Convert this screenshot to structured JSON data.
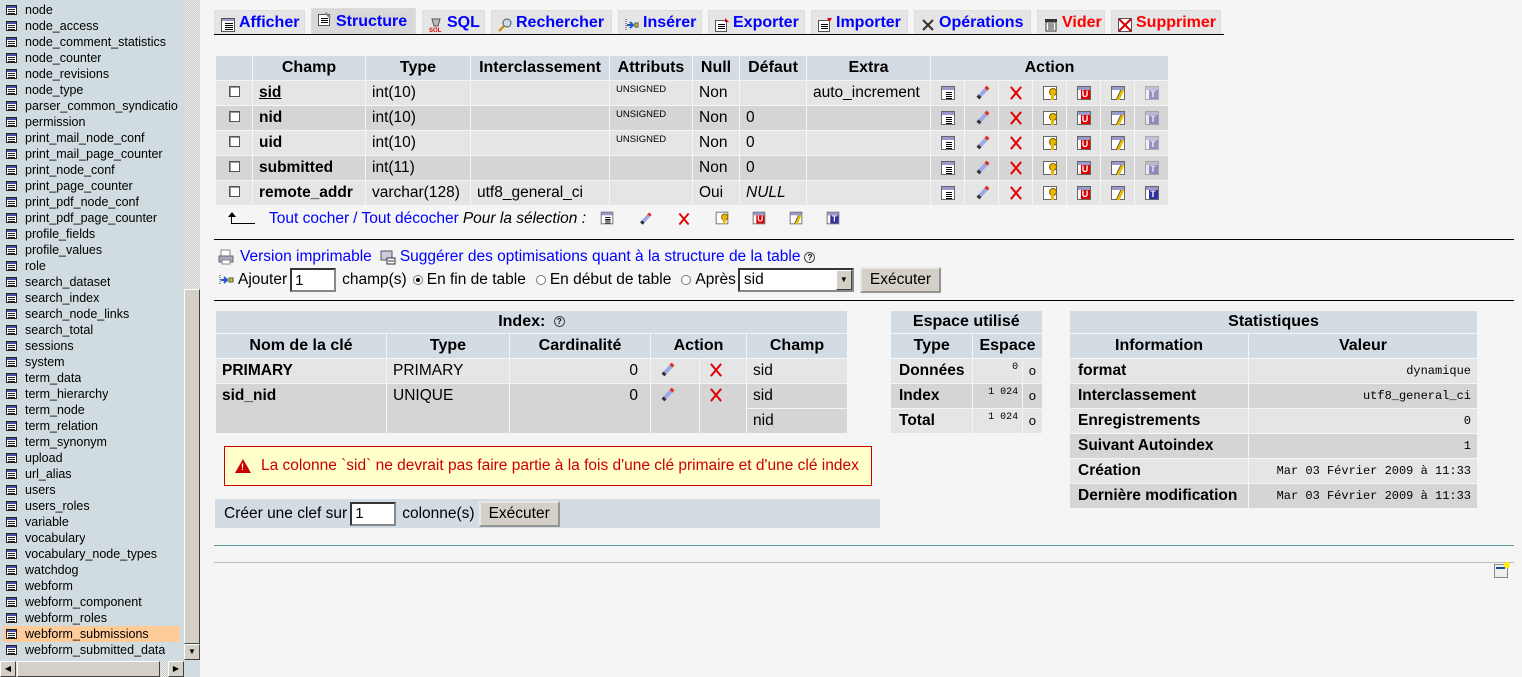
{
  "sidebar": {
    "tables": [
      "node",
      "node_access",
      "node_comment_statistics",
      "node_counter",
      "node_revisions",
      "node_type",
      "parser_common_syndicatio",
      "permission",
      "print_mail_node_conf",
      "print_mail_page_counter",
      "print_node_conf",
      "print_page_counter",
      "print_pdf_node_conf",
      "print_pdf_page_counter",
      "profile_fields",
      "profile_values",
      "role",
      "search_dataset",
      "search_index",
      "search_node_links",
      "search_total",
      "sessions",
      "system",
      "term_data",
      "term_hierarchy",
      "term_node",
      "term_relation",
      "term_synonym",
      "upload",
      "url_alias",
      "users",
      "users_roles",
      "variable",
      "vocabulary",
      "vocabulary_node_types",
      "watchdog",
      "webform",
      "webform_component",
      "webform_roles",
      "webform_submissions",
      "webform_submitted_data"
    ],
    "active_table": "webform_submissions",
    "active_color": "#ffcc99"
  },
  "tabs": [
    {
      "label": "Afficher",
      "icon": "browse-icon",
      "active": false,
      "danger": false
    },
    {
      "label": "Structure",
      "icon": "structure-icon",
      "active": true,
      "danger": false
    },
    {
      "label": "SQL",
      "icon": "sql-icon",
      "active": false,
      "danger": false
    },
    {
      "label": "Rechercher",
      "icon": "search-icon",
      "active": false,
      "danger": false
    },
    {
      "label": "Insérer",
      "icon": "insert-icon",
      "active": false,
      "danger": false
    },
    {
      "label": "Exporter",
      "icon": "export-icon",
      "active": false,
      "danger": false
    },
    {
      "label": "Importer",
      "icon": "import-icon",
      "active": false,
      "danger": false
    },
    {
      "label": "Opérations",
      "icon": "operations-icon",
      "active": false,
      "danger": false
    },
    {
      "label": "Vider",
      "icon": "empty-icon",
      "active": false,
      "danger": true
    },
    {
      "label": "Supprimer",
      "icon": "drop-icon",
      "active": false,
      "danger": true
    }
  ],
  "structure": {
    "headers": [
      "Champ",
      "Type",
      "Interclassement",
      "Attributs",
      "Null",
      "Défaut",
      "Extra",
      "Action"
    ],
    "rows": [
      {
        "field": "sid",
        "type": "int(10)",
        "collation": "",
        "attributes": "UNSIGNED",
        "null": "Non",
        "default": "",
        "extra": "auto_increment",
        "primary": true,
        "fulltext_enabled": false
      },
      {
        "field": "nid",
        "type": "int(10)",
        "collation": "",
        "attributes": "UNSIGNED",
        "null": "Non",
        "default": "0",
        "extra": "",
        "primary": false,
        "fulltext_enabled": false
      },
      {
        "field": "uid",
        "type": "int(10)",
        "collation": "",
        "attributes": "UNSIGNED",
        "null": "Non",
        "default": "0",
        "extra": "",
        "primary": false,
        "fulltext_enabled": false
      },
      {
        "field": "submitted",
        "type": "int(11)",
        "collation": "",
        "attributes": "",
        "null": "Non",
        "default": "0",
        "extra": "",
        "primary": false,
        "fulltext_enabled": false
      },
      {
        "field": "remote_addr",
        "type": "varchar(128)",
        "collation": "utf8_general_ci",
        "attributes": "",
        "null": "Oui",
        "default": "NULL",
        "extra": "",
        "primary": false,
        "fulltext_enabled": true
      }
    ],
    "action_icons": [
      "browse-icon",
      "edit-icon",
      "delete-icon",
      "primary-key-icon",
      "unique-icon",
      "index-icon",
      "fulltext-icon"
    ],
    "check_all": "Tout cocher",
    "separator": "/",
    "uncheck_all": "Tout décocher",
    "with_selected": "Pour la sélection :"
  },
  "tools": {
    "print_view": "Version imprimable",
    "propose_structure": "Suggérer des optimisations quant à la structure de la table",
    "add_label": "Ajouter",
    "add_count": "1",
    "fields_label": "champ(s)",
    "pos_end": "En fin de table",
    "pos_start": "En début de table",
    "pos_after": "Après",
    "after_field": "sid",
    "execute": "Exécuter"
  },
  "indexes": {
    "title": "Index:",
    "headers": [
      "Nom de la clé",
      "Type",
      "Cardinalité",
      "Action",
      "Champ"
    ],
    "rows": [
      {
        "name": "PRIMARY",
        "type": "PRIMARY",
        "cardinality": "0",
        "columns": [
          "sid"
        ]
      },
      {
        "name": "sid_nid",
        "type": "UNIQUE",
        "cardinality": "0",
        "columns": [
          "sid",
          "nid"
        ]
      }
    ],
    "warning": "La colonne `sid` ne devrait pas faire partie à la fois d'une clé primaire et d'une clé index",
    "create_label": "Créer une clef sur",
    "create_count": "1",
    "create_suffix": "colonne(s)",
    "create_button": "Exécuter"
  },
  "space": {
    "title": "Espace utilisé",
    "headers": [
      "Type",
      "Espace"
    ],
    "rows": [
      {
        "type": "Données",
        "value": "0",
        "unit": "o"
      },
      {
        "type": "Index",
        "value": "1 024",
        "unit": "o"
      },
      {
        "type": "Total",
        "value": "1 024",
        "unit": "o"
      }
    ]
  },
  "stats": {
    "title": "Statistiques",
    "headers": [
      "Information",
      "Valeur"
    ],
    "rows": [
      {
        "label": "format",
        "value": "dynamique"
      },
      {
        "label": "Interclassement",
        "value": "utf8_general_ci"
      },
      {
        "label": "Enregistrements",
        "value": "0"
      },
      {
        "label": "Suivant Autoindex",
        "value": "1"
      },
      {
        "label": "Création",
        "value": "Mar 03 Février 2009 à 11:33"
      },
      {
        "label": "Dernière modification",
        "value": "Mar 03 Février 2009 à 11:33"
      }
    ]
  }
}
